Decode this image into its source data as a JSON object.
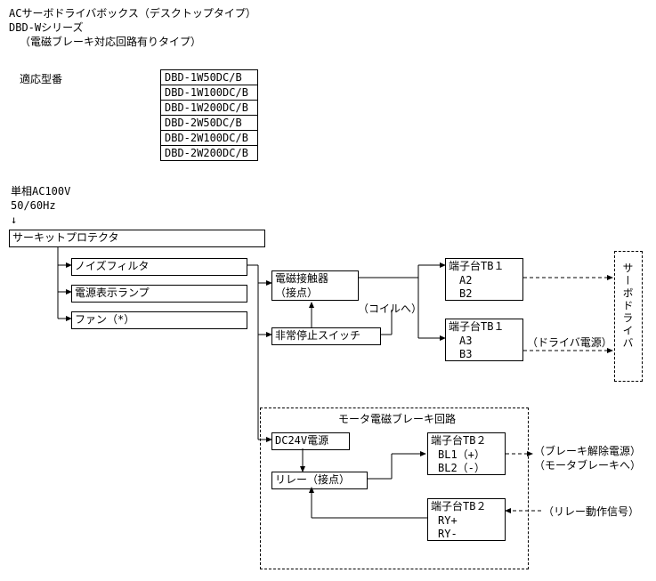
{
  "header": {
    "title": "ACサーボドライバボックス（デスクトップタイプ）",
    "series": "DBD-Wシリーズ",
    "subtitle": "（電磁ブレーキ対応回路有りタイプ）"
  },
  "models_label": "適応型番",
  "models": [
    "DBD-1W50DC/B",
    "DBD-1W100DC/B",
    "DBD-1W200DC/B",
    "DBD-2W50DC/B",
    "DBD-2W100DC/B",
    "DBD-2W200DC/B"
  ],
  "power": {
    "line1": "単相AC100V",
    "line2": "50/60Hz"
  },
  "blocks": {
    "circuit_protector": "サーキットプロテクタ",
    "noise_filter": "ノイズフィルタ",
    "power_indicator": "電源表示ランプ",
    "fan": "ファン（*）",
    "magnetic_contactor_l1": "電磁接触器",
    "magnetic_contactor_l2": "（接点）",
    "coil_note": "（コイルへ）",
    "estop": "非常停止スイッチ",
    "tb1a": {
      "title": "端子台TB１",
      "pin1": "A2",
      "pin2": "B2"
    },
    "tb1b": {
      "title": "端子台TB１",
      "pin1": "A3",
      "pin2": "B3"
    },
    "driver_power_note": "（ドライバ電源）",
    "servo_driver": "サーボドライバ"
  },
  "brake": {
    "title": "モータ電磁ブレーキ回路",
    "dc24v": "DC24V電源",
    "relay": "リレー（接点）",
    "tb2a": {
      "title": "端子台TB２",
      "pin1": "BL1（+）",
      "pin2": "BL2（-）"
    },
    "tb2b": {
      "title": "端子台TB２",
      "pin1": "RY+",
      "pin2": "RY-"
    },
    "note_release": "（ブレーキ解除電源）",
    "note_to_brake": "（モータブレーキへ）",
    "note_relay_signal": "（リレー動作信号）"
  }
}
